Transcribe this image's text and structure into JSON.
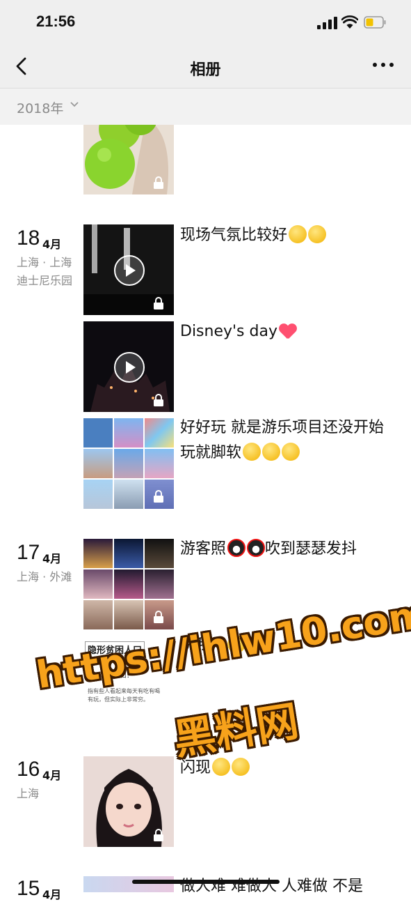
{
  "status": {
    "time": "21:56"
  },
  "nav": {
    "title": "相册"
  },
  "yearbar": {
    "label": "2018年"
  },
  "entries": [
    {
      "day": "18",
      "month": "4月",
      "location": "上海 · 上海迪士尼乐园"
    },
    {
      "day": "17",
      "month": "4月",
      "location": "上海 · 外滩"
    },
    {
      "day": "16",
      "month": "4月",
      "location": "上海"
    },
    {
      "day": "15",
      "month": "4月",
      "location": ""
    }
  ],
  "posts": {
    "p_fireworks": {
      "caption": "现场气氛比较好"
    },
    "p_disney": {
      "caption": "Disney's  day"
    },
    "p_fun": {
      "caption": "好好玩 就是游乐项目还没开始玩就脚软"
    },
    "p_tourist_a": {
      "caption": "游客照"
    },
    "p_tourist_b": {
      "caption": "吹到瑟瑟发抖"
    },
    "p_article": {
      "caption": "说我吗",
      "article_title": "隐形贫困人口",
      "article_pinyin": "yǐn xíng pín kùn rén kǒu",
      "article_sub": "隐形贫困人口：",
      "article_line1": "指有些人看起来每天有吃有喝",
      "article_line2": "有玩，但实际上非常穷。"
    },
    "p_selfie": {
      "caption": "闪现"
    },
    "p_last": {
      "caption": "做人难 难做人 人难做 不是"
    }
  },
  "watermark": {
    "url": "https://ihlw10.com",
    "cn": "黑料网"
  }
}
